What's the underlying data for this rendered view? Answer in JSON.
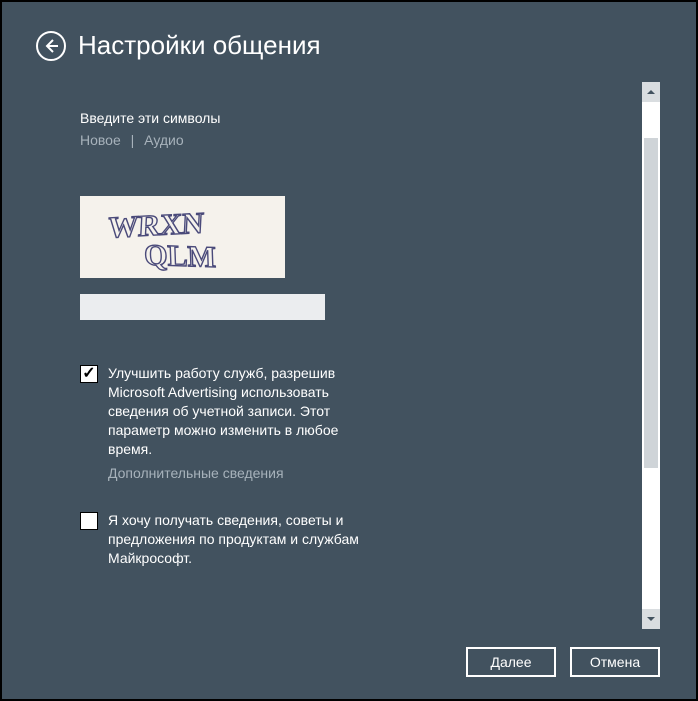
{
  "header": {
    "title": "Настройки общения"
  },
  "captcha": {
    "instruction": "Введите эти символы",
    "link_new": "Новое",
    "link_audio": "Аудио",
    "separator": "|",
    "text_line1": "WRXN",
    "text_line2": "QLM",
    "input_value": ""
  },
  "option1": {
    "checked": true,
    "label": "Улучшить работу служб, разрешив Microsoft Advertising использовать сведения об учетной записи. Этот параметр можно изменить в любое время.",
    "more": "Дополнительные сведения"
  },
  "option2": {
    "checked": false,
    "label": "Я хочу получать сведения, советы и предложения по продуктам и службам Майкрософт."
  },
  "footer": {
    "next": "Далее",
    "cancel": "Отмена"
  }
}
